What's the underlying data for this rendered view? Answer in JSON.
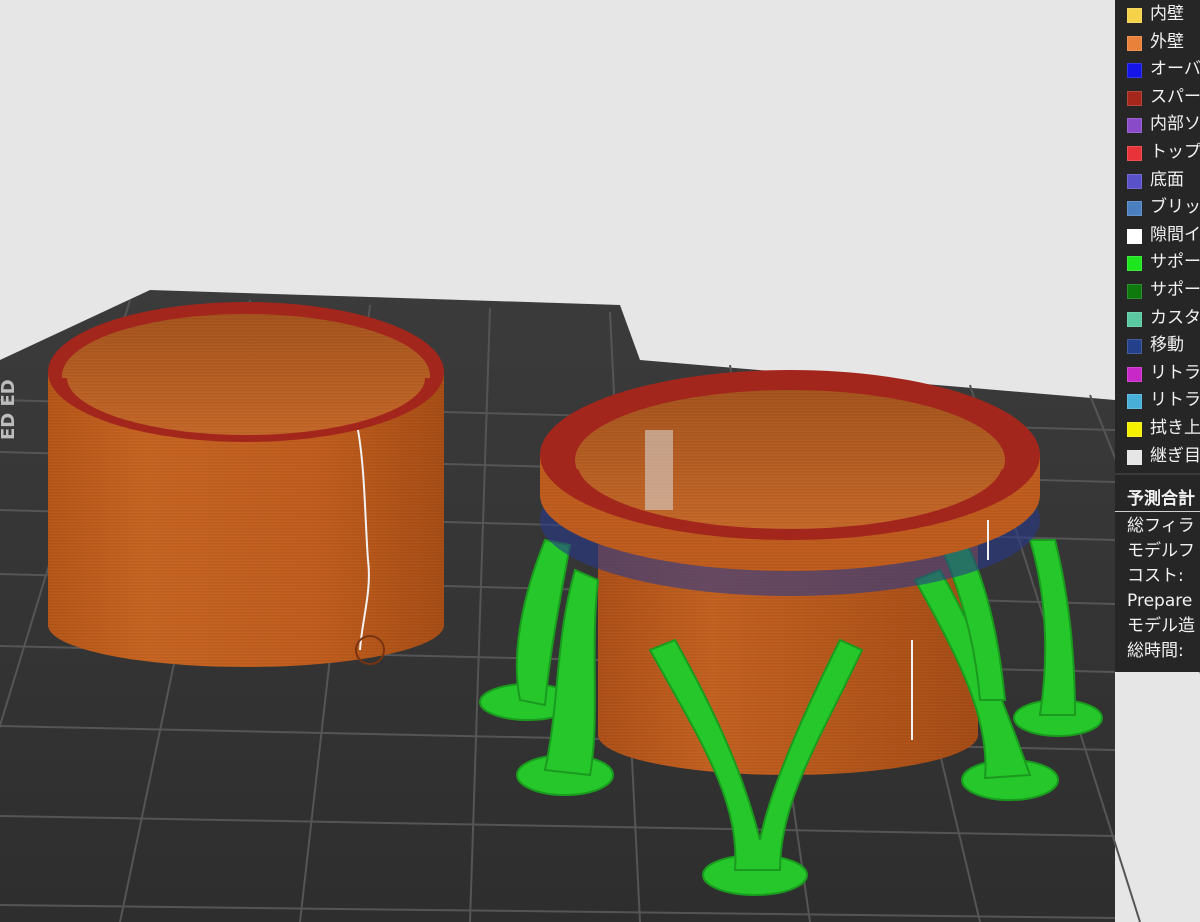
{
  "legend": {
    "items": [
      {
        "label": "内壁",
        "color": "#f5d24a"
      },
      {
        "label": "外壁",
        "color": "#e9813a"
      },
      {
        "label": "オーバ",
        "color": "#1515e8"
      },
      {
        "label": "スパー",
        "color": "#a5271c"
      },
      {
        "label": "内部ソ",
        "color": "#8a4bc8"
      },
      {
        "label": "トップ",
        "color": "#e8333a"
      },
      {
        "label": "底面",
        "color": "#5a50c8"
      },
      {
        "label": "ブリッ",
        "color": "#4a7fc0"
      },
      {
        "label": "隙間イ",
        "color": "#ffffff"
      },
      {
        "label": "サポー",
        "color": "#1ee61e"
      },
      {
        "label": "サポー",
        "color": "#0e7a0e"
      },
      {
        "label": "カスタ",
        "color": "#5ac8a0"
      },
      {
        "label": "移動",
        "color": "#24408a"
      },
      {
        "label": "リトラ",
        "color": "#c828c8"
      },
      {
        "label": "リトラ",
        "color": "#48b0d8"
      },
      {
        "label": "拭き上",
        "color": "#f5f000"
      },
      {
        "label": "継ぎ目",
        "color": "#e6e6e6"
      }
    ]
  },
  "estimate": {
    "title": "予測合計",
    "rows": [
      {
        "label": "総フィラ"
      },
      {
        "label": "モデルフ"
      },
      {
        "label": "コスト:"
      },
      {
        "label": "Prepare"
      },
      {
        "label": "モデル造"
      },
      {
        "label": "総時間:"
      }
    ]
  },
  "scene": {
    "bed_text": "ED ED"
  }
}
